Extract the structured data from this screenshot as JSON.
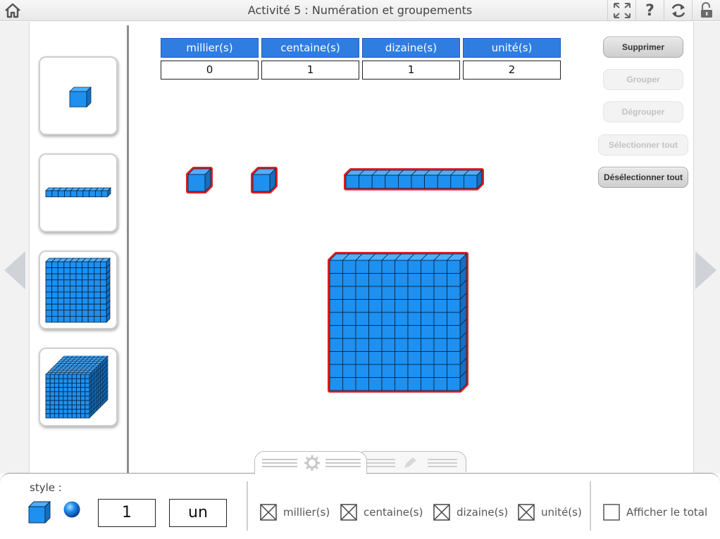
{
  "app": {
    "title": "Activité 5 : Numération et groupements"
  },
  "table": {
    "headers": [
      "millier(s)",
      "centaine(s)",
      "dizaine(s)",
      "unité(s)"
    ],
    "values": [
      "0",
      "1",
      "1",
      "2"
    ]
  },
  "actions": {
    "delete": "Supprimer",
    "group": "Grouper",
    "ungroup": "Dégrouper",
    "select_all": "Sélectionner tout",
    "deselect_all": "Désélectionner tout"
  },
  "actions_state": {
    "delete": "enabled",
    "group": "disabled",
    "ungroup": "disabled",
    "select_all": "disabled",
    "deselect_all": "enabled"
  },
  "palette": [
    "unit-cube",
    "ten-rod",
    "hundred-flat",
    "thousand-cube"
  ],
  "canvas": {
    "blocks": [
      "unit-cube",
      "unit-cube",
      "ten-rod",
      "hundred-flat"
    ],
    "selected": true
  },
  "bottom": {
    "style_label": "style :",
    "number_value": "1",
    "number_word": "un",
    "checkboxes": [
      {
        "label": "millier(s)",
        "checked": true
      },
      {
        "label": "centaine(s)",
        "checked": true
      },
      {
        "label": "dizaine(s)",
        "checked": true
      },
      {
        "label": "unité(s)",
        "checked": true
      }
    ],
    "total_label": "Afficher le total",
    "total_checked": false
  },
  "colors": {
    "block": "#1e90f0",
    "selection": "#e02020",
    "header": "#2f7de1"
  },
  "icons": [
    "home-icon",
    "fullscreen-icon",
    "help-icon",
    "refresh-icon",
    "unlock-icon",
    "arrow-left-icon",
    "arrow-right-icon",
    "gear-icon",
    "pencil-icon"
  ]
}
